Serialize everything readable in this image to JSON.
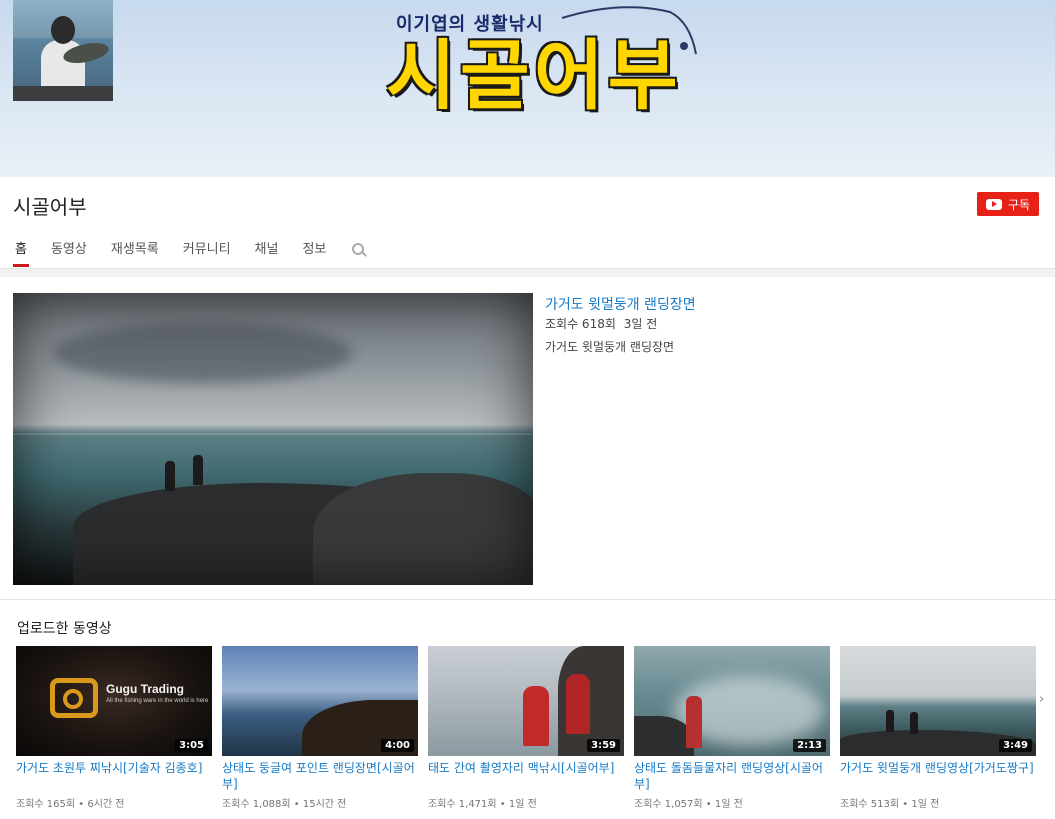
{
  "banner": {
    "subtitle": "이기엽의 생활낚시",
    "title": "시골어부"
  },
  "channel": {
    "name": "시골어부",
    "subscribe_label": "구독"
  },
  "tabs": [
    {
      "label": "홈",
      "active": true
    },
    {
      "label": "동영상"
    },
    {
      "label": "재생목록"
    },
    {
      "label": "커뮤니티"
    },
    {
      "label": "채널"
    },
    {
      "label": "정보"
    }
  ],
  "featured": {
    "title": "가거도 윗멀둥개 랜딩장면",
    "views": "조회수 618회",
    "time": "3일 전",
    "description": "가거도 윗멀둥개 랜딩장면"
  },
  "uploads": {
    "section_title": "업로드한 동영상",
    "videos": [
      {
        "title": "가거도 초원투 찌낚시[기술자 김종호]",
        "duration": "3:05",
        "views": "조회수 165회",
        "time": "6시간 전",
        "logo_text": "Gugu Trading",
        "logo_sub": "All the fishing ware in the world is here"
      },
      {
        "title": "상태도 둥글여 포인트 랜딩장면[시골어부]",
        "duration": "4:00",
        "views": "조회수 1,088회",
        "time": "15시간 전"
      },
      {
        "title": "태도 간여 촬영자리 맥낚시[시골어부]",
        "duration": "3:59",
        "views": "조회수 1,471회",
        "time": "1일 전"
      },
      {
        "title": "상태도 돌돔들물자리 랜딩영상[시골어부]",
        "duration": "2:13",
        "views": "조회수 1,057회",
        "time": "1일 전"
      },
      {
        "title": "가거도 윗멀둥개 랜딩영상[가거도짱구]",
        "duration": "3:49",
        "views": "조회수 513회",
        "time": "1일 전"
      }
    ]
  },
  "colors": {
    "accent_red": "#e62117",
    "link_blue": "#167ac6",
    "banner_yellow": "#ffd600"
  }
}
